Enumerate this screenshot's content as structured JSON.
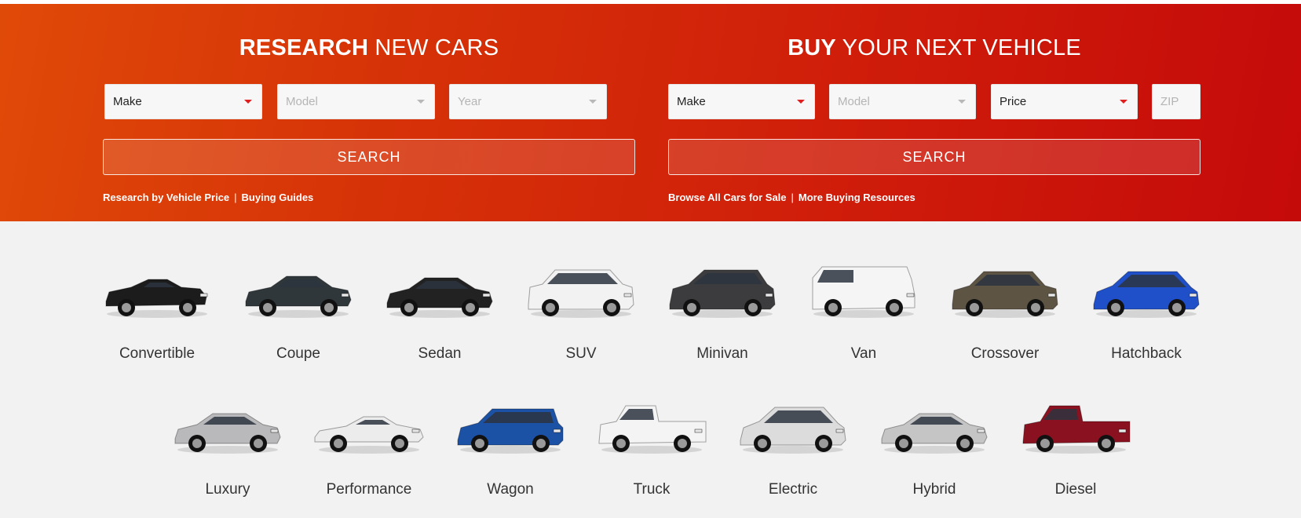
{
  "research": {
    "title_bold": "RESEARCH",
    "title_light": "NEW CARS",
    "make": "Make",
    "model": "Model",
    "year": "Year",
    "search": "SEARCH",
    "link1": "Research by Vehicle Price",
    "link2": "Buying Guides"
  },
  "buy": {
    "title_bold": "BUY",
    "title_light": "YOUR NEXT VEHICLE",
    "make": "Make",
    "model": "Model",
    "price": "Price",
    "zip_placeholder": "ZIP",
    "search": "SEARCH",
    "link1": "Browse All Cars for Sale",
    "link2": "More Buying Resources"
  },
  "separator": "|",
  "vehicles_row1": [
    {
      "label": "Convertible",
      "color": "#1c1c1c",
      "shape": "convertible"
    },
    {
      "label": "Coupe",
      "color": "#2f373b",
      "shape": "coupe"
    },
    {
      "label": "Sedan",
      "color": "#222222",
      "shape": "sedan"
    },
    {
      "label": "SUV",
      "color": "#f2f2f2",
      "shape": "suv"
    },
    {
      "label": "Minivan",
      "color": "#3c3c3e",
      "shape": "minivan"
    },
    {
      "label": "Van",
      "color": "#f5f5f5",
      "shape": "van"
    },
    {
      "label": "Crossover",
      "color": "#5e5444",
      "shape": "crossover"
    },
    {
      "label": "Hatchback",
      "color": "#1f4fc9",
      "shape": "hatch"
    }
  ],
  "vehicles_row2": [
    {
      "label": "Luxury",
      "color": "#b9b9bb",
      "shape": "sedan"
    },
    {
      "label": "Performance",
      "color": "#ececec",
      "shape": "sport"
    },
    {
      "label": "Wagon",
      "color": "#1c52a6",
      "shape": "wagon"
    },
    {
      "label": "Truck",
      "color": "#f4f4f4",
      "shape": "truck"
    },
    {
      "label": "Electric",
      "color": "#dcdcdc",
      "shape": "hatch"
    },
    {
      "label": "Hybrid",
      "color": "#c5c5c5",
      "shape": "sedan"
    },
    {
      "label": "Diesel",
      "color": "#8a1220",
      "shape": "truck"
    }
  ]
}
